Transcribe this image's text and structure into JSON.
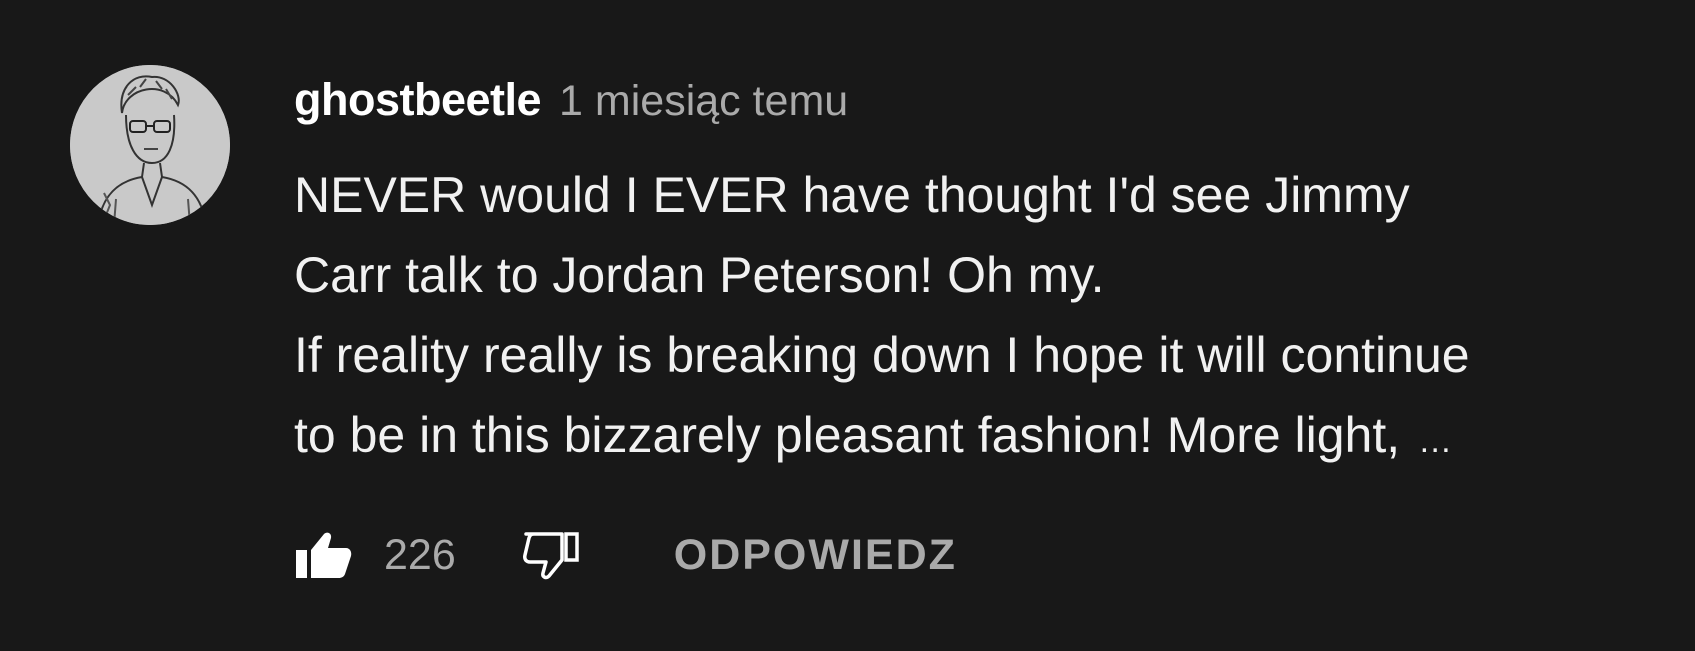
{
  "comment": {
    "author": "ghostbeetle",
    "timestamp": "1 miesiąc temu",
    "lines": [
      "NEVER would I EVER have thought I'd see Jimmy",
      "Carr talk to Jordan Peterson! Oh my.",
      "If reality really is breaking down I hope it will continue",
      "to be in this bizzarely pleasant fashion! More light,"
    ],
    "ellipsis": "…",
    "avatar_icon": "sketch-portrait-avatar"
  },
  "actions": {
    "like_icon": "thumbs-up-icon",
    "like_count": "226",
    "dislike_icon": "thumbs-down-icon",
    "reply_label": "ODPOWIEDZ"
  },
  "colors": {
    "background": "#181818",
    "text_primary": "#ffffff",
    "text_secondary": "#aaaaaa",
    "link": "#3ea6ff"
  }
}
